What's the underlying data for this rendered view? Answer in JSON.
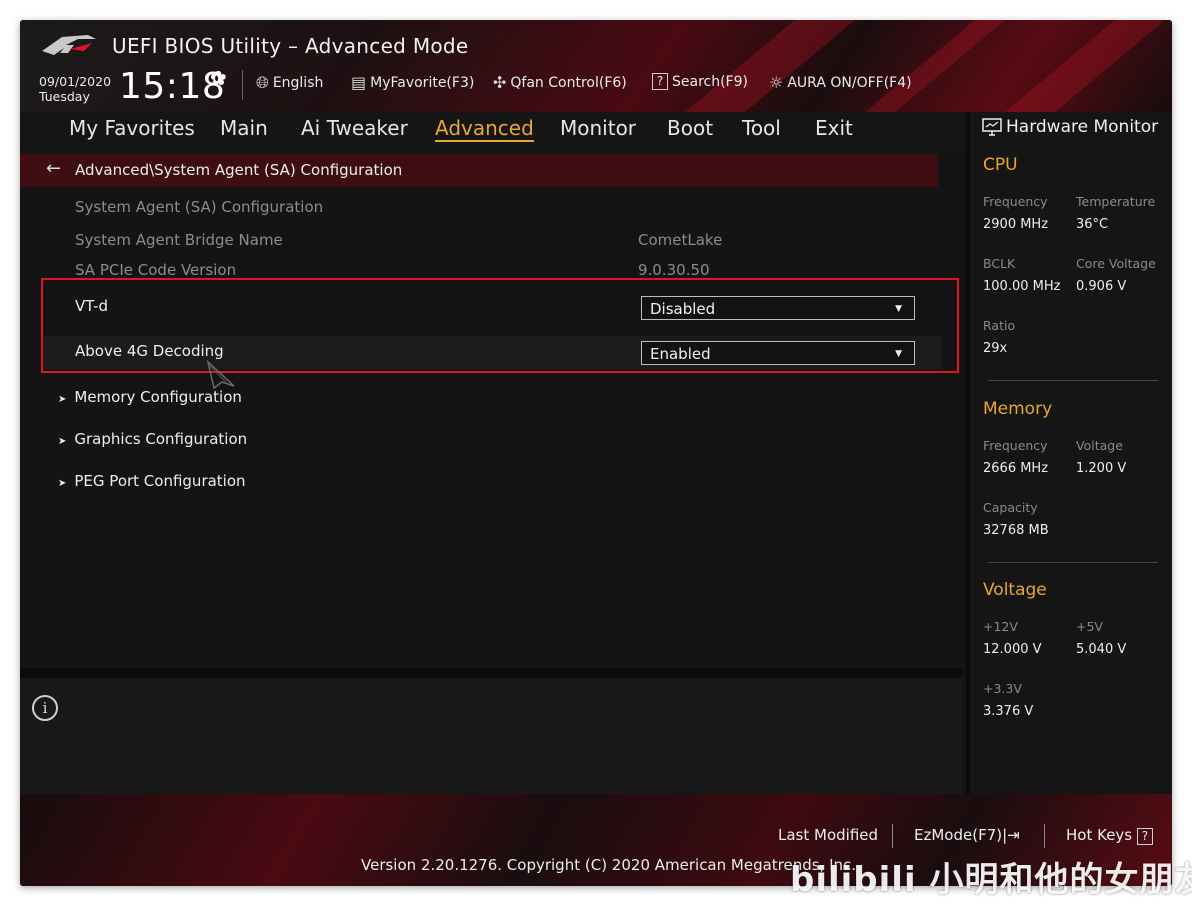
{
  "app": {
    "title": "UEFI BIOS Utility – Advanced Mode"
  },
  "header": {
    "date": "09/01/2020",
    "day": "Tuesday",
    "time": "15:18",
    "tools": [
      {
        "label": "English",
        "icon": "globe-icon"
      },
      {
        "label": "MyFavorite(F3)",
        "icon": "favorite-list-icon"
      },
      {
        "label": "Qfan Control(F6)",
        "icon": "fan-icon"
      },
      {
        "label": "Search(F9)",
        "icon": "question-box-icon"
      },
      {
        "label": "AURA ON/OFF(F4)",
        "icon": "aura-light-icon"
      }
    ]
  },
  "tabs": [
    "My Favorites",
    "Main",
    "Ai Tweaker",
    "Advanced",
    "Monitor",
    "Boot",
    "Tool",
    "Exit"
  ],
  "active_tab": "Advanced",
  "accent_color": "#e8a632",
  "highlight_color": "#e0161d",
  "breadcrumb": "Advanced\\System Agent (SA) Configuration",
  "content": {
    "section_title": "System Agent (SA) Configuration",
    "info_rows": [
      {
        "label": "System Agent Bridge Name",
        "value": "CometLake"
      },
      {
        "label": "SA PCIe Code Version",
        "value": "9.0.30.50"
      }
    ],
    "settings": [
      {
        "label": "VT-d",
        "value": "Disabled"
      },
      {
        "label": "Above 4G Decoding",
        "value": "Enabled"
      }
    ],
    "submenus": [
      "Memory Configuration",
      "Graphics Configuration",
      "PEG Port Configuration"
    ]
  },
  "hardware_monitor": {
    "title": "Hardware Monitor",
    "cpu": {
      "title": "CPU",
      "frequency_label": "Frequency",
      "frequency": "2900 MHz",
      "temperature_label": "Temperature",
      "temperature": "36°C",
      "bclk_label": "BCLK",
      "bclk": "100.00 MHz",
      "core_voltage_label": "Core Voltage",
      "core_voltage": "0.906 V",
      "ratio_label": "Ratio",
      "ratio": "29x"
    },
    "memory": {
      "title": "Memory",
      "frequency_label": "Frequency",
      "frequency": "2666 MHz",
      "voltage_label": "Voltage",
      "voltage": "1.200 V",
      "capacity_label": "Capacity",
      "capacity": "32768 MB"
    },
    "voltage": {
      "title": "Voltage",
      "v12_label": "+12V",
      "v12": "12.000 V",
      "v5_label": "+5V",
      "v5": "5.040 V",
      "v33_label": "+3.3V",
      "v33": "3.376 V"
    }
  },
  "footer": {
    "last_modified": "Last Modified",
    "ezmode": "EzMode(F7)|",
    "hotkeys": "Hot Keys",
    "version": "Version 2.20.1276. Copyright (C) 2020 American Megatrends, Inc."
  },
  "watermark": "bilibili 小明和他的女朋友"
}
